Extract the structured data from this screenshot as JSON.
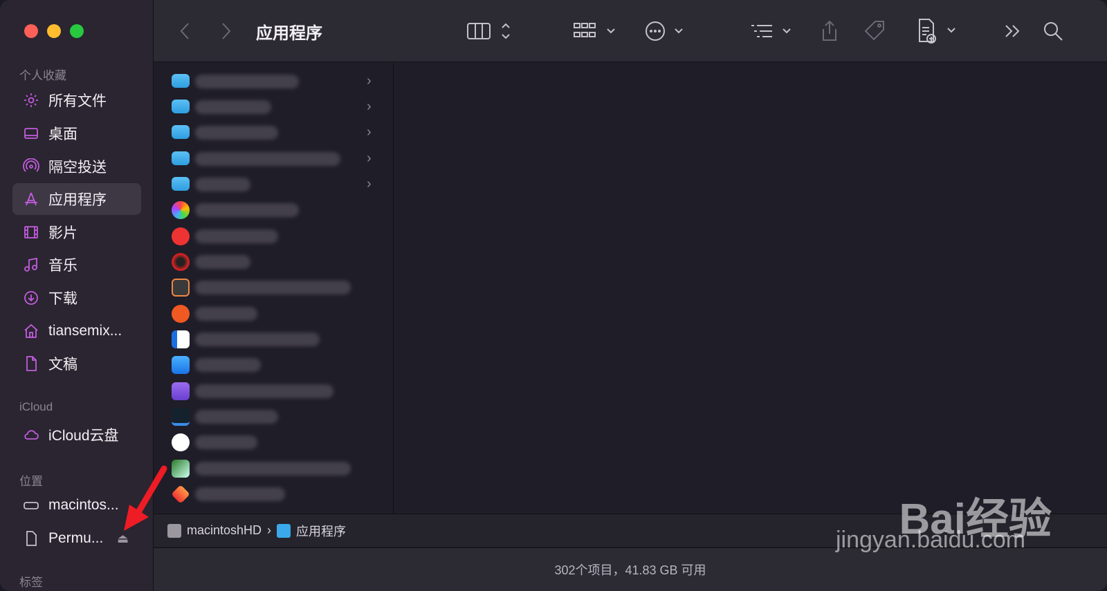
{
  "window": {
    "title": "应用程序"
  },
  "sidebar": {
    "favorites_title": "个人收藏",
    "items": [
      {
        "label": "所有文件",
        "icon": "gear-icon"
      },
      {
        "label": "桌面",
        "icon": "desktop-icon"
      },
      {
        "label": "隔空投送",
        "icon": "airdrop-icon"
      },
      {
        "label": "应用程序",
        "icon": "apps-icon",
        "active": true
      },
      {
        "label": "影片",
        "icon": "film-icon"
      },
      {
        "label": "音乐",
        "icon": "music-icon"
      },
      {
        "label": "下载",
        "icon": "download-icon"
      },
      {
        "label": "tiansemix...",
        "icon": "home-icon"
      },
      {
        "label": "文稿",
        "icon": "document-icon"
      }
    ],
    "icloud_title": "iCloud",
    "icloud_item": {
      "label": "iCloud云盘",
      "icon": "cloud-icon"
    },
    "locations_title": "位置",
    "location_items": [
      {
        "label": "macintos...",
        "icon": "disk-icon"
      },
      {
        "label": "Permu...",
        "icon": "file-icon",
        "eject": "⏏"
      }
    ],
    "tags_title": "标签"
  },
  "pathbar": {
    "root": "macintoshHD",
    "separator": "›",
    "current": "应用程序"
  },
  "statusbar": {
    "text": "302个项目，41.83 GB 可用"
  },
  "watermark": {
    "brand": "Bai经验",
    "url": "jingyan.baidu.com"
  },
  "accent_color": "#c45ce0"
}
